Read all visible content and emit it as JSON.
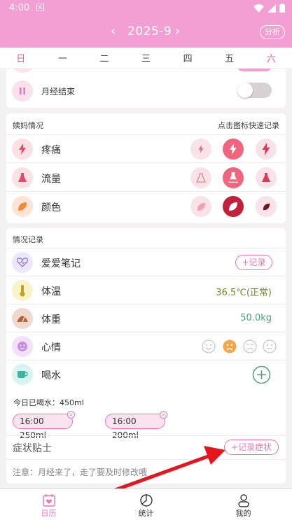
{
  "status_bar": {
    "time": "4:00",
    "notif_letter": "A"
  },
  "header": {
    "month": "2025-9",
    "prev_icon": "‹",
    "next_icon": "›",
    "analyze_label": "分析"
  },
  "weekdays": [
    "日",
    "一",
    "二",
    "三",
    "四",
    "五",
    "六"
  ],
  "period_end": {
    "label": "月经结束",
    "on": false
  },
  "aunt": {
    "title": "姨妈情况",
    "hint": "点击图标快速记录",
    "rows": [
      {
        "label": "疼痛",
        "icon": "lightning-icon",
        "selected": 1
      },
      {
        "label": "流量",
        "icon": "flask-icon",
        "selected": 1
      },
      {
        "label": "颜色",
        "icon": "leaf-icon",
        "selected": 1
      }
    ]
  },
  "records": {
    "title": "情况记录",
    "love": {
      "label": "爱爱笔记",
      "button": "+记录"
    },
    "temp": {
      "label": "体温",
      "value": "36.5℃(正常)"
    },
    "weight": {
      "label": "体重",
      "value": "50.0kg"
    },
    "mood": {
      "label": "心情",
      "selected": 1
    },
    "water": {
      "label": "喝水",
      "summary": "今日已喝水：450ml",
      "entries": [
        "16:00 250ml",
        "16:00 200ml"
      ]
    }
  },
  "symptoms": {
    "title": "症状贴士",
    "button": "+记录症状",
    "note": "注意：月经来了，走了要及时修改哦"
  },
  "nav": [
    {
      "label": "日历",
      "icon": "calendar-heart-icon",
      "active": true
    },
    {
      "label": "统计",
      "icon": "pie-chart-icon",
      "active": false
    },
    {
      "label": "我的",
      "icon": "person-icon",
      "active": false
    }
  ],
  "colors": {
    "pink": "#f49fd3",
    "accent": "#ec74b2",
    "temp_green": "#6a8f2b",
    "weight_green": "#4aa07e",
    "arrow": "#e5151d"
  }
}
